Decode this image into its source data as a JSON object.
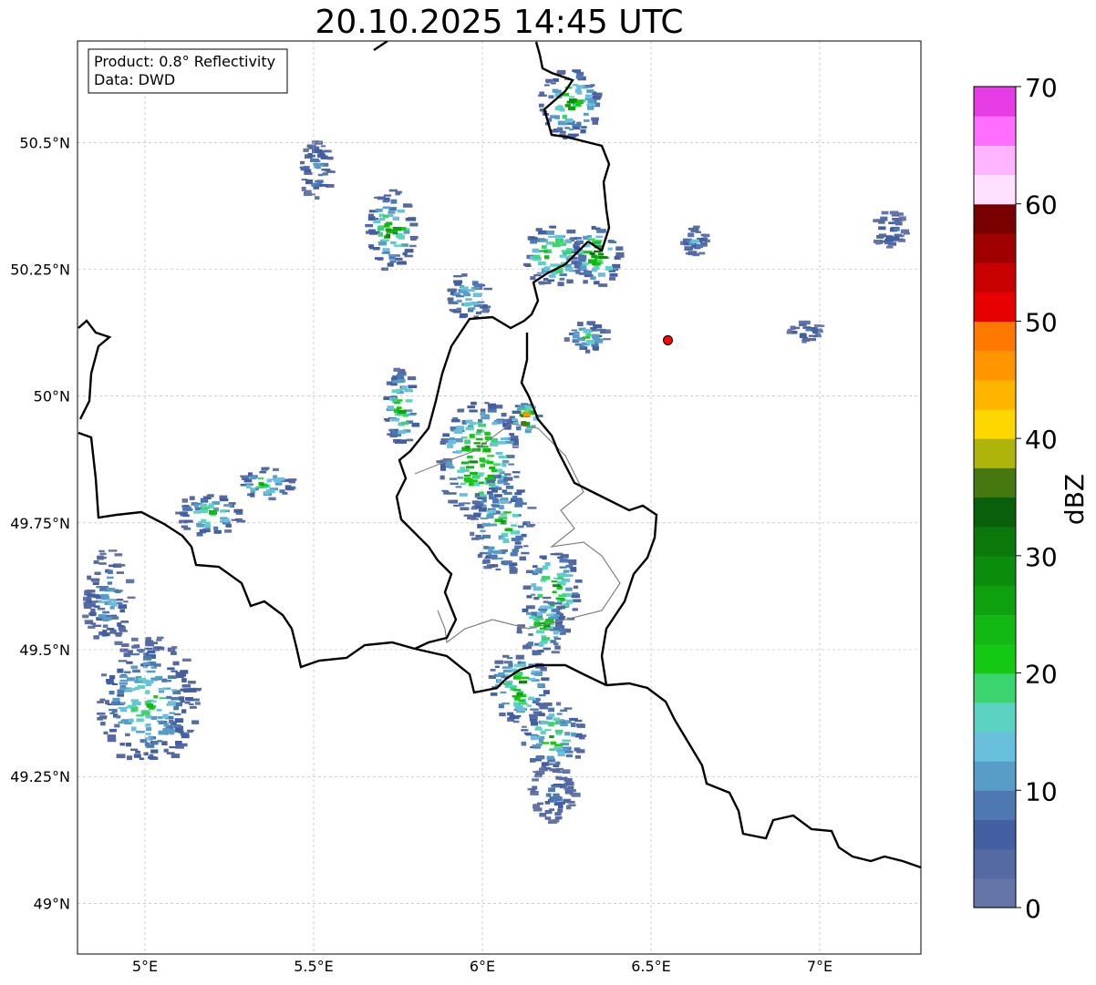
{
  "title": "20.10.2025 14:45 UTC",
  "infobox": {
    "product": "Product: 0.8° Reflectivity",
    "data": "Data: DWD"
  },
  "axes": {
    "x_ticks": [
      "5°E",
      "5.5°E",
      "6°E",
      "6.5°E",
      "7°E"
    ],
    "y_ticks": [
      "50.5°N",
      "50.25°N",
      "50°N",
      "49.75°N",
      "49.5°N",
      "49.25°N",
      "49°N"
    ]
  },
  "colorbar": {
    "label": "dBZ",
    "tick_labels": [
      "0",
      "10",
      "20",
      "30",
      "40",
      "50",
      "60",
      "70"
    ],
    "colors": [
      "#6475a8",
      "#556aa3",
      "#435fa2",
      "#4d78b2",
      "#589dc7",
      "#68c0dd",
      "#5cd3c2",
      "#3cd46f",
      "#14c814",
      "#12b814",
      "#0fa00f",
      "#0c8c0c",
      "#0a780a",
      "#0a600a",
      "#467810",
      "#afb40a",
      "#ffd700",
      "#ffb400",
      "#ff9600",
      "#ff7800",
      "#e60000",
      "#c80000",
      "#a00000",
      "#780000",
      "#ffe1ff",
      "#ffb4ff",
      "#ff6eff",
      "#e63ce6"
    ]
  },
  "radar_site": {
    "lon": 6.55,
    "lat": 50.11,
    "color": "#ff0000"
  },
  "echo_cells": [
    {
      "lon": 5.0,
      "lat": 49.4,
      "rx": 0.15,
      "ry": 0.13,
      "peak": 24
    },
    {
      "lon": 4.88,
      "lat": 49.6,
      "rx": 0.07,
      "ry": 0.1,
      "peak": 16
    },
    {
      "lon": 5.72,
      "lat": 50.33,
      "rx": 0.07,
      "ry": 0.08,
      "peak": 30
    },
    {
      "lon": 5.95,
      "lat": 50.2,
      "rx": 0.06,
      "ry": 0.05,
      "peak": 22
    },
    {
      "lon": 5.75,
      "lat": 49.98,
      "rx": 0.05,
      "ry": 0.08,
      "peak": 28
    },
    {
      "lon": 5.98,
      "lat": 49.88,
      "rx": 0.12,
      "ry": 0.12,
      "peak": 36
    },
    {
      "lon": 6.05,
      "lat": 49.75,
      "rx": 0.09,
      "ry": 0.1,
      "peak": 26
    },
    {
      "lon": 6.2,
      "lat": 49.62,
      "rx": 0.08,
      "ry": 0.08,
      "peak": 34
    },
    {
      "lon": 6.17,
      "lat": 49.55,
      "rx": 0.07,
      "ry": 0.06,
      "peak": 30
    },
    {
      "lon": 6.1,
      "lat": 49.43,
      "rx": 0.09,
      "ry": 0.07,
      "peak": 32
    },
    {
      "lon": 6.2,
      "lat": 49.33,
      "rx": 0.09,
      "ry": 0.07,
      "peak": 28
    },
    {
      "lon": 6.2,
      "lat": 49.22,
      "rx": 0.07,
      "ry": 0.06,
      "peak": 12
    },
    {
      "lon": 6.25,
      "lat": 50.58,
      "rx": 0.09,
      "ry": 0.07,
      "peak": 30
    },
    {
      "lon": 6.2,
      "lat": 50.28,
      "rx": 0.09,
      "ry": 0.06,
      "peak": 34
    },
    {
      "lon": 6.33,
      "lat": 50.28,
      "rx": 0.07,
      "ry": 0.06,
      "peak": 36
    },
    {
      "lon": 6.3,
      "lat": 50.12,
      "rx": 0.06,
      "ry": 0.03,
      "peak": 24
    },
    {
      "lon": 6.12,
      "lat": 49.96,
      "rx": 0.04,
      "ry": 0.03,
      "peak": 50
    },
    {
      "lon": 5.18,
      "lat": 49.77,
      "rx": 0.1,
      "ry": 0.04,
      "peak": 26
    },
    {
      "lon": 5.35,
      "lat": 49.83,
      "rx": 0.08,
      "ry": 0.03,
      "peak": 28
    },
    {
      "lon": 6.95,
      "lat": 50.13,
      "rx": 0.05,
      "ry": 0.02,
      "peak": 12
    },
    {
      "lon": 6.62,
      "lat": 50.31,
      "rx": 0.04,
      "ry": 0.03,
      "peak": 14
    },
    {
      "lon": 7.2,
      "lat": 50.33,
      "rx": 0.05,
      "ry": 0.04,
      "peak": 12
    },
    {
      "lon": 5.5,
      "lat": 50.45,
      "rx": 0.05,
      "ry": 0.06,
      "peak": 14
    }
  ]
}
